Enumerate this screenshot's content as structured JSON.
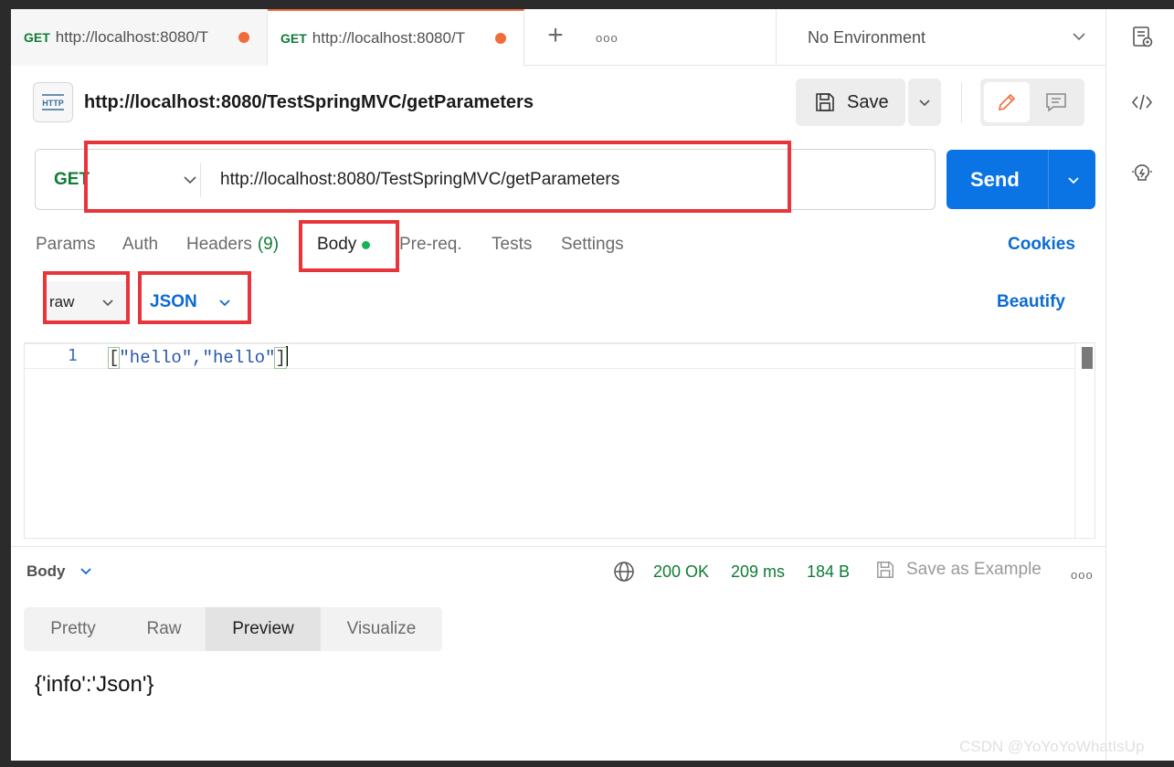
{
  "tabs": [
    {
      "method": "GET",
      "url": "http://localhost:8080/T"
    },
    {
      "method": "GET",
      "url": "http://localhost:8080/T"
    }
  ],
  "tab_more": "ooo",
  "environment": "No Environment",
  "request": {
    "icon_label": "HTTP",
    "name": "http://localhost:8080/TestSpringMVC/getParameters",
    "save_label": "Save",
    "method": "GET",
    "url": "http://localhost:8080/TestSpringMVC/getParameters",
    "send_label": "Send"
  },
  "request_tabs": {
    "params": "Params",
    "auth": "Auth",
    "headers": "Headers",
    "headers_count": "(9)",
    "body": "Body",
    "prereq": "Pre-req.",
    "tests": "Tests",
    "settings": "Settings",
    "cookies": "Cookies"
  },
  "body_options": {
    "mode": "raw",
    "language": "JSON",
    "beautify": "Beautify"
  },
  "editor": {
    "line_number": "1",
    "code_open": "[",
    "code_mid": "\"hello\",\"hello\"",
    "code_close": "]"
  },
  "response": {
    "label": "Body",
    "status": "200 OK",
    "time": "209 ms",
    "size": "184 B",
    "save_example": "Save as Example",
    "more": "ooo",
    "view_tabs": [
      "Pretty",
      "Raw",
      "Preview",
      "Visualize"
    ],
    "active_view": "Preview",
    "preview_text": "{'info':'Json'}"
  },
  "watermark": "CSDN @YoYoYoWhatIsUp",
  "colors": {
    "accent_orange": "#f26b3a",
    "method_green": "#0f7b35",
    "send_blue": "#0b74e5",
    "link_blue": "#0b6bd3",
    "annotation_red": "#e8353b"
  }
}
